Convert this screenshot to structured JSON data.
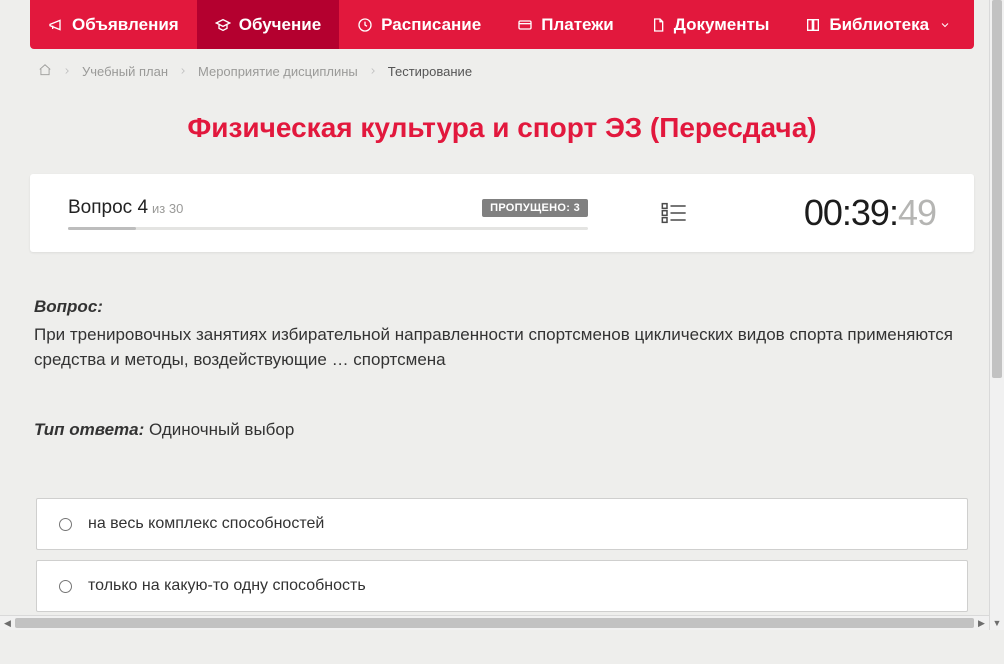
{
  "nav": {
    "items": [
      {
        "label": "Объявления",
        "active": false
      },
      {
        "label": "Обучение",
        "active": true
      },
      {
        "label": "Расписание",
        "active": false
      },
      {
        "label": "Платежи",
        "active": false
      },
      {
        "label": "Документы",
        "active": false
      },
      {
        "label": "Библиотека",
        "active": false,
        "dropdown": true
      }
    ]
  },
  "breadcrumb": {
    "items": [
      "Учебный план",
      "Мероприятие дисциплины"
    ],
    "current": "Тестирование"
  },
  "title": "Физическая культура и спорт ЭЗ (Пересдача)",
  "status": {
    "question_label": "Вопрос 4",
    "of_label": "из 30",
    "skipped_label": "ПРОПУЩЕНО: 3",
    "timer_main": "00:39:",
    "timer_seconds": "49"
  },
  "question": {
    "heading": "Вопрос:",
    "text": "При тренировочных занятиях избирательной направленности спортсменов циклических видов спорта применяются средства и методы, воздействующие … спортсмена",
    "answer_type_label": "Тип ответа:",
    "answer_type_value": "Одиночный выбор",
    "options": [
      "на весь комплекс способностей",
      "только на какую-то одну способность"
    ]
  }
}
